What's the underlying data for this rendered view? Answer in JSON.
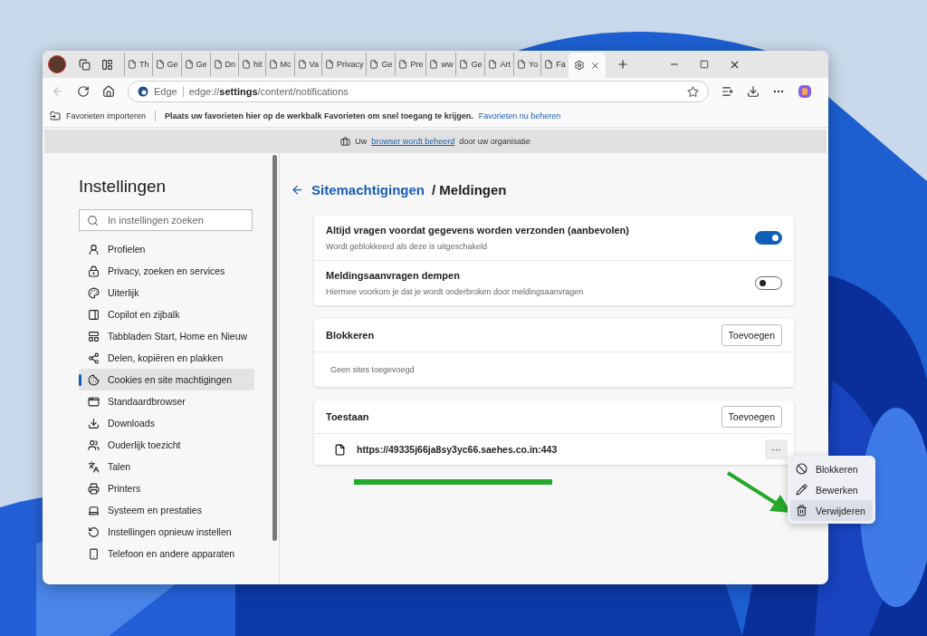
{
  "tabs": [
    {
      "label": "Th",
      "selected": false
    },
    {
      "label": "Ge",
      "selected": false
    },
    {
      "label": "Ge",
      "selected": false
    },
    {
      "label": "Dn",
      "selected": false
    },
    {
      "label": "hit",
      "selected": false
    },
    {
      "label": "Mc",
      "selected": false
    },
    {
      "label": "Va",
      "selected": false
    },
    {
      "label": "Privacy",
      "selected": false
    },
    {
      "label": "Ge",
      "selected": false
    },
    {
      "label": "Pre",
      "selected": false
    },
    {
      "label": "ww",
      "selected": false
    },
    {
      "label": "Ge",
      "selected": false
    },
    {
      "label": "Art",
      "selected": false
    },
    {
      "label": "Yo",
      "selected": false
    },
    {
      "label": "Fa",
      "selected": false
    },
    {
      "selected": true
    }
  ],
  "address_bar": {
    "badge": "Edge",
    "url": "edge://**settings**/content/notifications"
  },
  "favorites_bar": {
    "import": "Favorieten importeren",
    "hint": "Plaats uw favorieten hier op de werkbalk Favorieten om snel toegang te krijgen.",
    "link": "Favorieten nu beheren"
  },
  "managed_banner": {
    "before": "Uw",
    "link": "browser wordt beheerd",
    "after": "door uw organisatie"
  },
  "sidebar": {
    "title": "Instellingen",
    "search_placeholder": "In instellingen zoeken",
    "items": [
      {
        "label": "Profielen",
        "selected": false
      },
      {
        "label": "Privacy, zoeken en services",
        "selected": false
      },
      {
        "label": "Uiterlijk",
        "selected": false
      },
      {
        "label": "Copilot en zijbalk",
        "selected": false
      },
      {
        "label": "Tabbladen Start, Home en Nieuw",
        "selected": false
      },
      {
        "label": "Delen, kopiëren en plakken",
        "selected": false
      },
      {
        "label": "Cookies en site machtigingen",
        "selected": true
      },
      {
        "label": "Standaardbrowser",
        "selected": false
      },
      {
        "label": "Downloads",
        "selected": false
      },
      {
        "label": "Ouderlijk toezicht",
        "selected": false
      },
      {
        "label": "Talen",
        "selected": false
      },
      {
        "label": "Printers",
        "selected": false
      },
      {
        "label": "Systeem en prestaties",
        "selected": false
      },
      {
        "label": "Instellingen opnieuw instellen",
        "selected": false
      },
      {
        "label": "Telefoon en andere apparaten",
        "selected": false
      }
    ]
  },
  "page": {
    "breadcrumb_link": "Sitemachtigingen",
    "breadcrumb_current": "/ Meldingen"
  },
  "settings": [
    {
      "title": "Altijd vragen voordat gegevens worden verzonden (aanbevolen)",
      "description": "Wordt geblokkeerd als deze is uitgeschakeld",
      "on": true
    },
    {
      "title": "Meldingsaanvragen dempen",
      "description": "Hiermee voorkom je dat je wordt onderbroken door meldingsaanvragen",
      "on": false
    }
  ],
  "sections": [
    {
      "title": "Blokkeren",
      "button": "Toevoegen",
      "empty": "Geen sites toegevoegd"
    },
    {
      "title": "Toestaan",
      "button": "Toevoegen",
      "sites": [
        {
          "url": "https://49335j66ja8sy3yc66.saehes.co.in:443",
          "more": "···"
        }
      ]
    }
  ],
  "context_menu": [
    {
      "label": "Blokkeren",
      "hovered": false
    },
    {
      "label": "Bewerken",
      "hovered": false
    },
    {
      "label": "Verwijderen",
      "hovered": true
    }
  ]
}
